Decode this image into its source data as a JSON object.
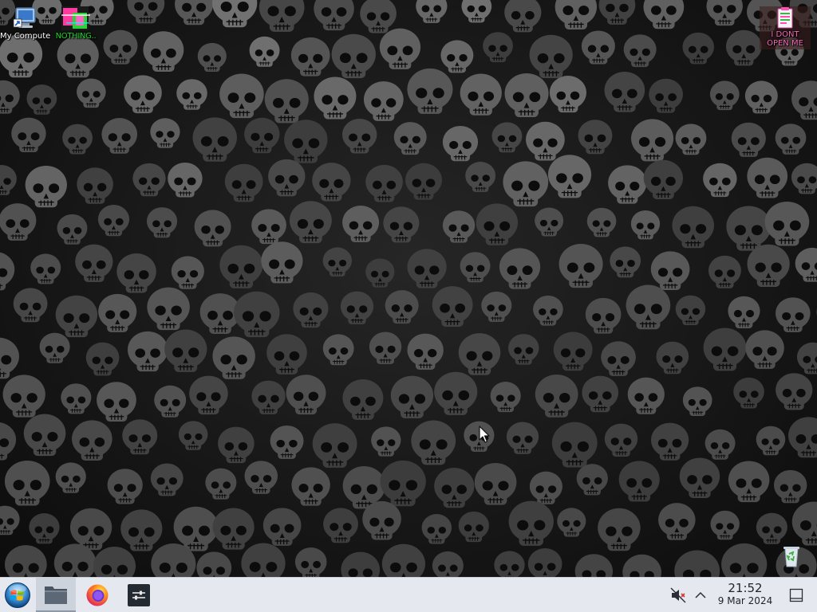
{
  "desktop": {
    "icons": [
      {
        "id": "my-computer",
        "label": "My Computer"
      },
      {
        "id": "nothing",
        "label": "NOTHING.."
      },
      {
        "id": "dont-open",
        "label": "I DONT OPEN ME"
      },
      {
        "id": "recycle-bin",
        "label": ""
      }
    ]
  },
  "taskbar": {
    "start_icon": "windows-orb-icon",
    "pinned": [
      {
        "name": "file-manager",
        "icon": "folder-icon",
        "active": true
      },
      {
        "name": "firefox",
        "icon": "firefox-icon",
        "active": false
      },
      {
        "name": "terminal",
        "icon": "terminal-icon",
        "active": false
      }
    ],
    "tray": {
      "volume_icon": "volume-muted-icon",
      "expand_icon": "chevron-up-icon",
      "show_desktop_icon": "show-desktop-icon"
    },
    "clock": {
      "time": "21:52",
      "date": "9 Mar 2024"
    }
  },
  "colors": {
    "taskbar_bg": "#e5e9ef",
    "accent_green": "#1bd62a",
    "accent_pink": "#f16ab7",
    "wallpaper_tone": "#2a2a2a"
  }
}
